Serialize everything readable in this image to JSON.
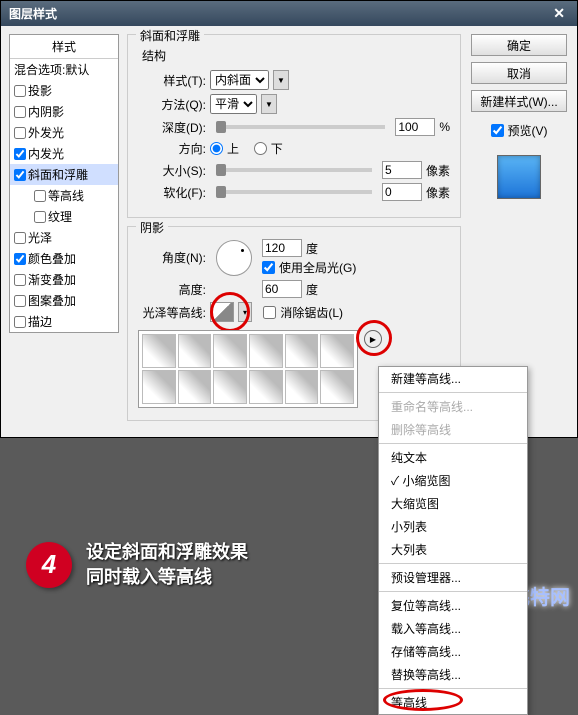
{
  "titlebar": {
    "title": "图层样式",
    "close": "✕"
  },
  "leftList": {
    "header": "样式",
    "blend": "混合选项:默认",
    "items": [
      {
        "label": "投影",
        "checked": false
      },
      {
        "label": "内阴影",
        "checked": false
      },
      {
        "label": "外发光",
        "checked": false
      },
      {
        "label": "内发光",
        "checked": true
      },
      {
        "label": "斜面和浮雕",
        "checked": true,
        "active": true
      },
      {
        "label": "等高线",
        "checked": false,
        "sub": true
      },
      {
        "label": "纹理",
        "checked": false,
        "sub": true
      },
      {
        "label": "光泽",
        "checked": false
      },
      {
        "label": "颜色叠加",
        "checked": true
      },
      {
        "label": "渐变叠加",
        "checked": false
      },
      {
        "label": "图案叠加",
        "checked": false
      },
      {
        "label": "描边",
        "checked": false
      }
    ]
  },
  "bevel": {
    "groupTitle": "斜面和浮雕",
    "structTitle": "结构",
    "styleLbl": "样式(T):",
    "styleVal": "内斜面",
    "methodLbl": "方法(Q):",
    "methodVal": "平滑",
    "depthLbl": "深度(D):",
    "depthVal": "100",
    "depthUnit": "%",
    "dirLbl": "方向:",
    "dirUp": "上",
    "dirDown": "下",
    "sizeLbl": "大小(S):",
    "sizeVal": "5",
    "sizeUnit": "像素",
    "softenLbl": "软化(F):",
    "softenVal": "0",
    "softenUnit": "像素"
  },
  "shade": {
    "groupTitle": "阴影",
    "angleLbl": "角度(N):",
    "angleVal": "120",
    "angleUnit": "度",
    "globalLbl": "使用全局光(G)",
    "altLbl": "高度:",
    "altVal": "60",
    "altUnit": "度",
    "glossLbl": "光泽等高线:",
    "antiLbl": "消除锯齿(L)"
  },
  "right": {
    "ok": "确定",
    "cancel": "取消",
    "newStyle": "新建样式(W)...",
    "previewLbl": "预览(V)"
  },
  "menu": {
    "newContour": "新建等高线...",
    "rename": "重命名等高线...",
    "delete": "删除等高线",
    "textOnly": "纯文本",
    "smallThumb": "小缩览图",
    "largeThumb": "大缩览图",
    "smallList": "小列表",
    "largeList": "大列表",
    "presetMgr": "预设管理器...",
    "reset": "复位等高线...",
    "load": "载入等高线...",
    "save": "存储等高线...",
    "replace": "替换等高线...",
    "contours": "等高线"
  },
  "step": {
    "num": "4",
    "line1": "设定斜面和浮雕效果",
    "line2": "同时载入等高线"
  },
  "logo": "飞特网"
}
